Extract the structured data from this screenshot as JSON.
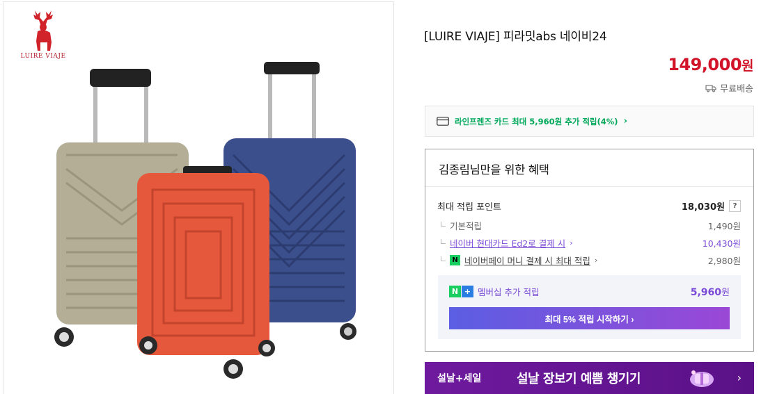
{
  "brand": {
    "logo_text": "LUIRE VIAJE"
  },
  "product": {
    "title": "[LUIRE VIAJE] 피라밋abs 네이비24",
    "price": "149,000",
    "price_unit": "원",
    "shipping": "무료배송",
    "image_icon": "luggage-set-image"
  },
  "card_banner": {
    "text": "라인프렌즈 카드 최대 5,960원 추가 적립(4%)",
    "chevron": "›"
  },
  "benefits": {
    "title": "김종림님만을 위한 혜택",
    "max_points_label": "최대 적립 포인트",
    "max_points_value": "18,030원",
    "help": "?",
    "rows": [
      {
        "label": "기본적립",
        "value": "1,490원"
      },
      {
        "label": "네이버 현대카드 Ed2로 결제 시",
        "value": "10,430원"
      },
      {
        "label": "네이버페이 머니 결제 시 최대 적립",
        "value": "2,980원"
      }
    ],
    "membership": {
      "n": "N",
      "plus": "+",
      "label": "멤버십 추가 적립",
      "value": "5,960",
      "unit": "원",
      "button": "최대 5% 적립 시작하기 ›"
    }
  },
  "promo": {
    "tag": "설날+세일",
    "text": "설날 장보기 예쁨 챙기기",
    "arrow": "›"
  },
  "colors": {
    "price": "#d2142a",
    "green": "#00a85a",
    "purple": "#7b4bd6",
    "promo_bg": "#6f1a9e"
  }
}
